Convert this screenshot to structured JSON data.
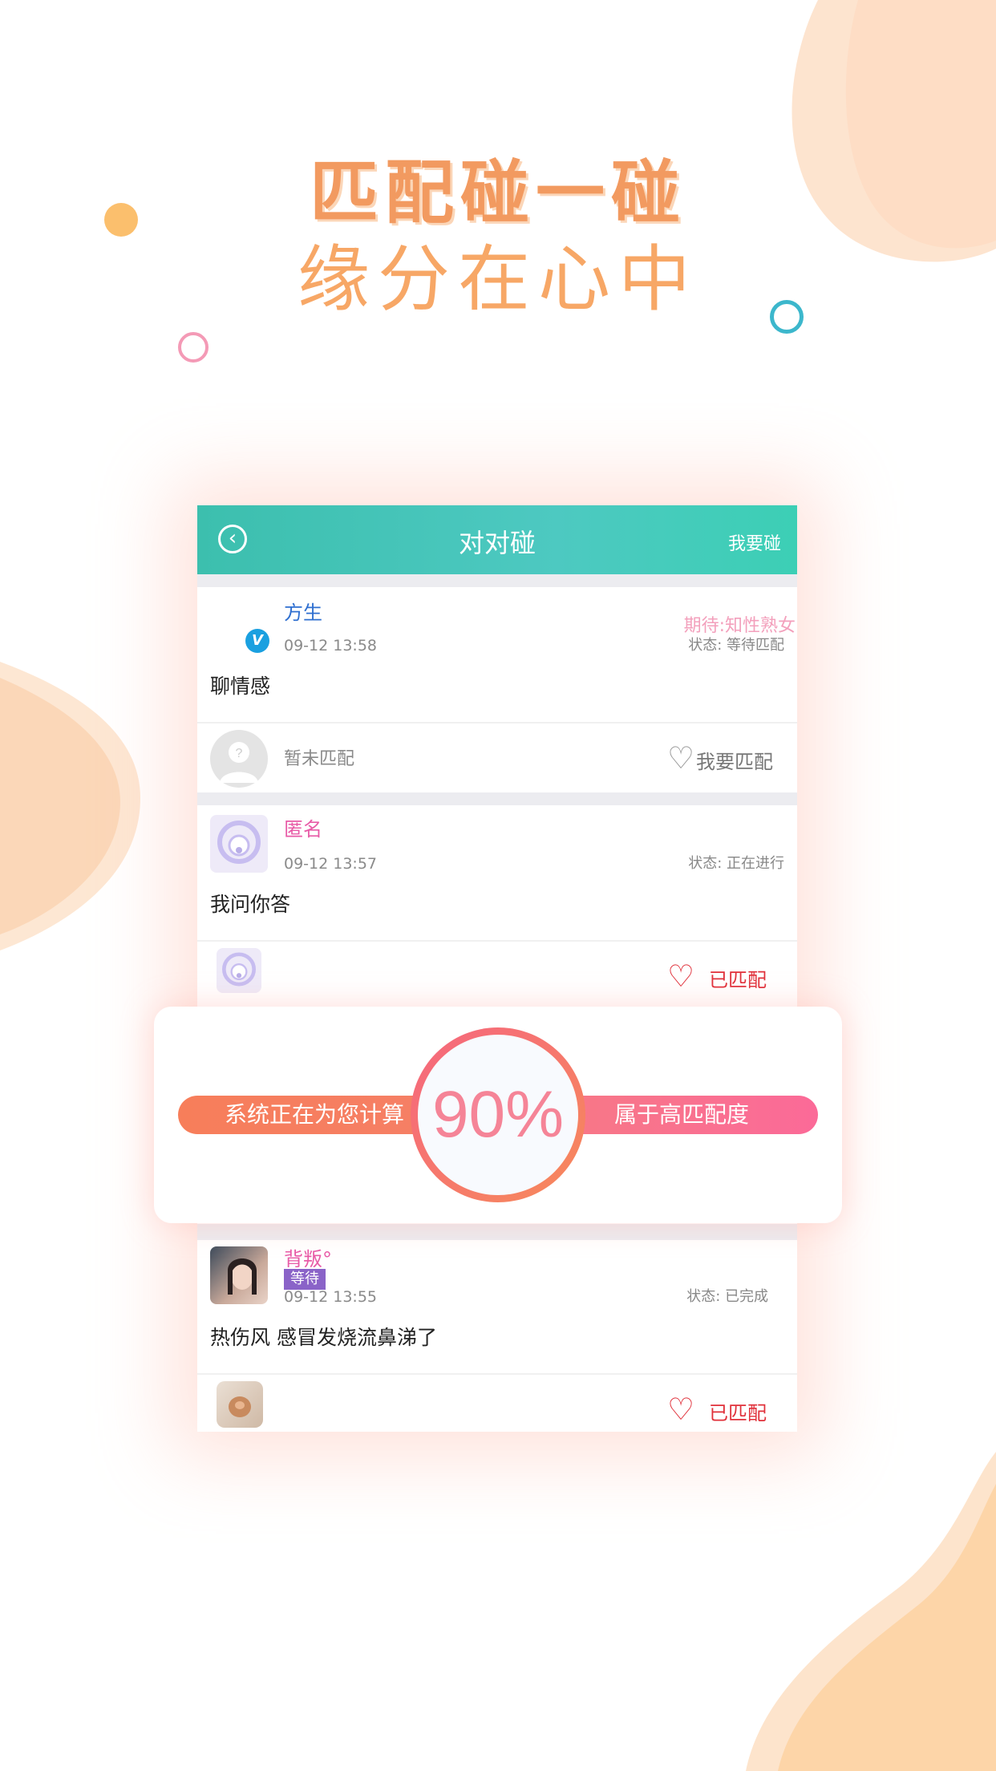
{
  "promo": {
    "headline": "匹配碰一碰",
    "subheadline": "缘分在心中"
  },
  "navbar": {
    "title": "对对碰",
    "action": "我要碰",
    "back_glyph": "‹"
  },
  "posts": [
    {
      "author": "方生",
      "author_color": "#2f6fd0",
      "badge": "V",
      "time": "09-12 13:58",
      "expect": "期待:知性熟女",
      "status": "状态: 等待匹配",
      "content": "聊情感",
      "match_label": "暂未匹配",
      "action": "我要匹配"
    },
    {
      "author": "匿名",
      "author_color": "#e85ba7",
      "time": "09-12 13:57",
      "status": "状态: 正在进行",
      "content": "我问你答",
      "action": "已匹配"
    },
    {
      "author": "背叛°",
      "author_color": "#e85ba7",
      "tag": "等待",
      "time": "09-12 13:55",
      "status": "状态: 已完成",
      "content": "热伤风 感冒发烧流鼻涕了",
      "action": "已匹配"
    }
  ],
  "overlay": {
    "left_label": "系统正在为您计算",
    "percent": "90%",
    "right_label": "属于高匹配度"
  },
  "colors": {
    "accent_teal": "#45c6b8",
    "headline_orange": "#f29a60",
    "matched_red": "#e0303a"
  }
}
